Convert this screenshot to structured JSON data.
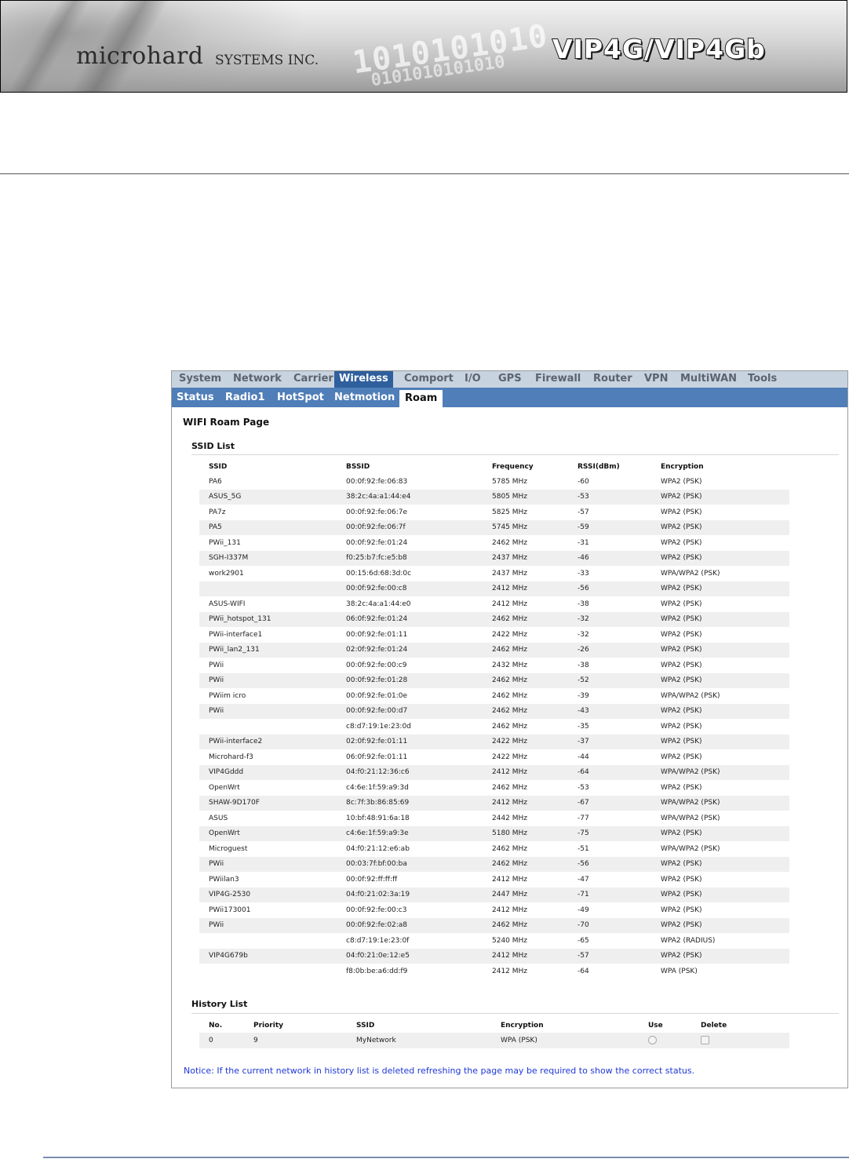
{
  "header": {
    "brand": "microhard",
    "brand_suffix": "SYSTEMS INC.",
    "binary_line1": "1010101010",
    "binary_line2": "0101010101010",
    "product": "VIP4G/VIP4Gb"
  },
  "nav": {
    "main_tabs": [
      "System",
      "Network",
      "Carrier",
      "Wireless",
      "Comport",
      "I/O",
      "GPS",
      "Firewall",
      "Router",
      "VPN",
      "MultiWAN",
      "Tools"
    ],
    "main_active": "Wireless",
    "sub_tabs": [
      "Status",
      "Radio1",
      "HotSpot",
      "Netmotion",
      "Roam"
    ],
    "sub_active": "Roam"
  },
  "page": {
    "title": "WIFI Roam Page"
  },
  "ssid_list": {
    "title": "SSID List",
    "columns": [
      "SSID",
      "BSSID",
      "Frequency",
      "RSSI(dBm)",
      "Encryption"
    ],
    "rows": [
      [
        "PA6",
        "00:0f:92:fe:06:83",
        "5785 MHz",
        "-60",
        "WPA2 (PSK)"
      ],
      [
        "ASUS_5G",
        "38:2c:4a:a1:44:e4",
        "5805 MHz",
        "-53",
        "WPA2 (PSK)"
      ],
      [
        "PA7z",
        "00:0f:92:fe:06:7e",
        "5825 MHz",
        "-57",
        "WPA2 (PSK)"
      ],
      [
        "PA5",
        "00:0f:92:fe:06:7f",
        "5745 MHz",
        "-59",
        "WPA2 (PSK)"
      ],
      [
        "PWii_131",
        "00:0f:92:fe:01:24",
        "2462 MHz",
        "-31",
        "WPA2 (PSK)"
      ],
      [
        "SGH-I337M",
        "f0:25:b7:fc:e5:b8",
        "2437 MHz",
        "-46",
        "WPA2 (PSK)"
      ],
      [
        "work2901",
        "00:15:6d:68:3d:0c",
        "2437 MHz",
        "-33",
        "WPA/WPA2 (PSK)"
      ],
      [
        "",
        "00:0f:92:fe:00:c8",
        "2412 MHz",
        "-56",
        "WPA2 (PSK)"
      ],
      [
        "ASUS-WIFI",
        "38:2c:4a:a1:44:e0",
        "2412 MHz",
        "-38",
        "WPA2 (PSK)"
      ],
      [
        "PWii_hotspot_131",
        "06:0f:92:fe:01:24",
        "2462 MHz",
        "-32",
        "WPA2 (PSK)"
      ],
      [
        "PWii-interface1",
        "00:0f:92:fe:01:11",
        "2422 MHz",
        "-32",
        "WPA2 (PSK)"
      ],
      [
        "PWii_lan2_131",
        "02:0f:92:fe:01:24",
        "2462 MHz",
        "-26",
        "WPA2 (PSK)"
      ],
      [
        "PWii",
        "00:0f:92:fe:00:c9",
        "2432 MHz",
        "-38",
        "WPA2 (PSK)"
      ],
      [
        "PWii",
        "00:0f:92:fe:01:28",
        "2462 MHz",
        "-52",
        "WPA2 (PSK)"
      ],
      [
        "PWiim icro",
        "00:0f:92:fe:01:0e",
        "2462 MHz",
        "-39",
        "WPA/WPA2 (PSK)"
      ],
      [
        "PWii",
        "00:0f:92:fe:00:d7",
        "2462 MHz",
        "-43",
        "WPA2 (PSK)"
      ],
      [
        "",
        "c8:d7:19:1e:23:0d",
        "2462 MHz",
        "-35",
        "WPA2 (PSK)"
      ],
      [
        "PWii-interface2",
        "02:0f:92:fe:01:11",
        "2422 MHz",
        "-37",
        "WPA2 (PSK)"
      ],
      [
        "Microhard-f3",
        "06:0f:92:fe:01:11",
        "2422 MHz",
        "-44",
        "WPA2 (PSK)"
      ],
      [
        "VIP4Gddd",
        "04:f0:21:12:36:c6",
        "2412 MHz",
        "-64",
        "WPA/WPA2 (PSK)"
      ],
      [
        "OpenWrt",
        "c4:6e:1f:59:a9:3d",
        "2462 MHz",
        "-53",
        "WPA2 (PSK)"
      ],
      [
        "SHAW-9D170F",
        "8c:7f:3b:86:85:69",
        "2412 MHz",
        "-67",
        "WPA/WPA2 (PSK)"
      ],
      [
        "ASUS",
        "10:bf:48:91:6a:18",
        "2442 MHz",
        "-77",
        "WPA/WPA2 (PSK)"
      ],
      [
        "OpenWrt",
        "c4:6e:1f:59:a9:3e",
        "5180 MHz",
        "-75",
        "WPA2 (PSK)"
      ],
      [
        "Microguest",
        "04:f0:21:12:e6:ab",
        "2462 MHz",
        "-51",
        "WPA/WPA2 (PSK)"
      ],
      [
        "PWii",
        "00:03:7f:bf:00:ba",
        "2462 MHz",
        "-56",
        "WPA2 (PSK)"
      ],
      [
        "PWiilan3",
        "00:0f:92:ff:ff:ff",
        "2412 MHz",
        "-47",
        "WPA2 (PSK)"
      ],
      [
        "VIP4G-2530",
        "04:f0:21:02:3a:19",
        "2447 MHz",
        "-71",
        "WPA2 (PSK)"
      ],
      [
        "PWii173001",
        "00:0f:92:fe:00:c3",
        "2412 MHz",
        "-49",
        "WPA2 (PSK)"
      ],
      [
        "PWii",
        "00:0f:92:fe:02:a8",
        "2462 MHz",
        "-70",
        "WPA2 (PSK)"
      ],
      [
        "",
        "c8:d7:19:1e:23:0f",
        "5240 MHz",
        "-65",
        "WPA2 (RADIUS)"
      ],
      [
        "VIP4G679b",
        "04:f0:21:0e:12:e5",
        "2412 MHz",
        "-57",
        "WPA2 (PSK)"
      ],
      [
        "",
        "f8:0b:be:a6:dd:f9",
        "2412 MHz",
        "-64",
        "WPA (PSK)"
      ]
    ]
  },
  "history_list": {
    "title": "History List",
    "columns": [
      "No.",
      "Priority",
      "SSID",
      "Encryption",
      "Use",
      "Delete"
    ],
    "rows": [
      {
        "no": "0",
        "priority": "9",
        "ssid": "MyNetwork",
        "encryption": "WPA (PSK)",
        "use": false,
        "delete": false
      }
    ]
  },
  "notice": "Notice: If the current network in history list is deleted refreshing the page may be required to show the correct status."
}
